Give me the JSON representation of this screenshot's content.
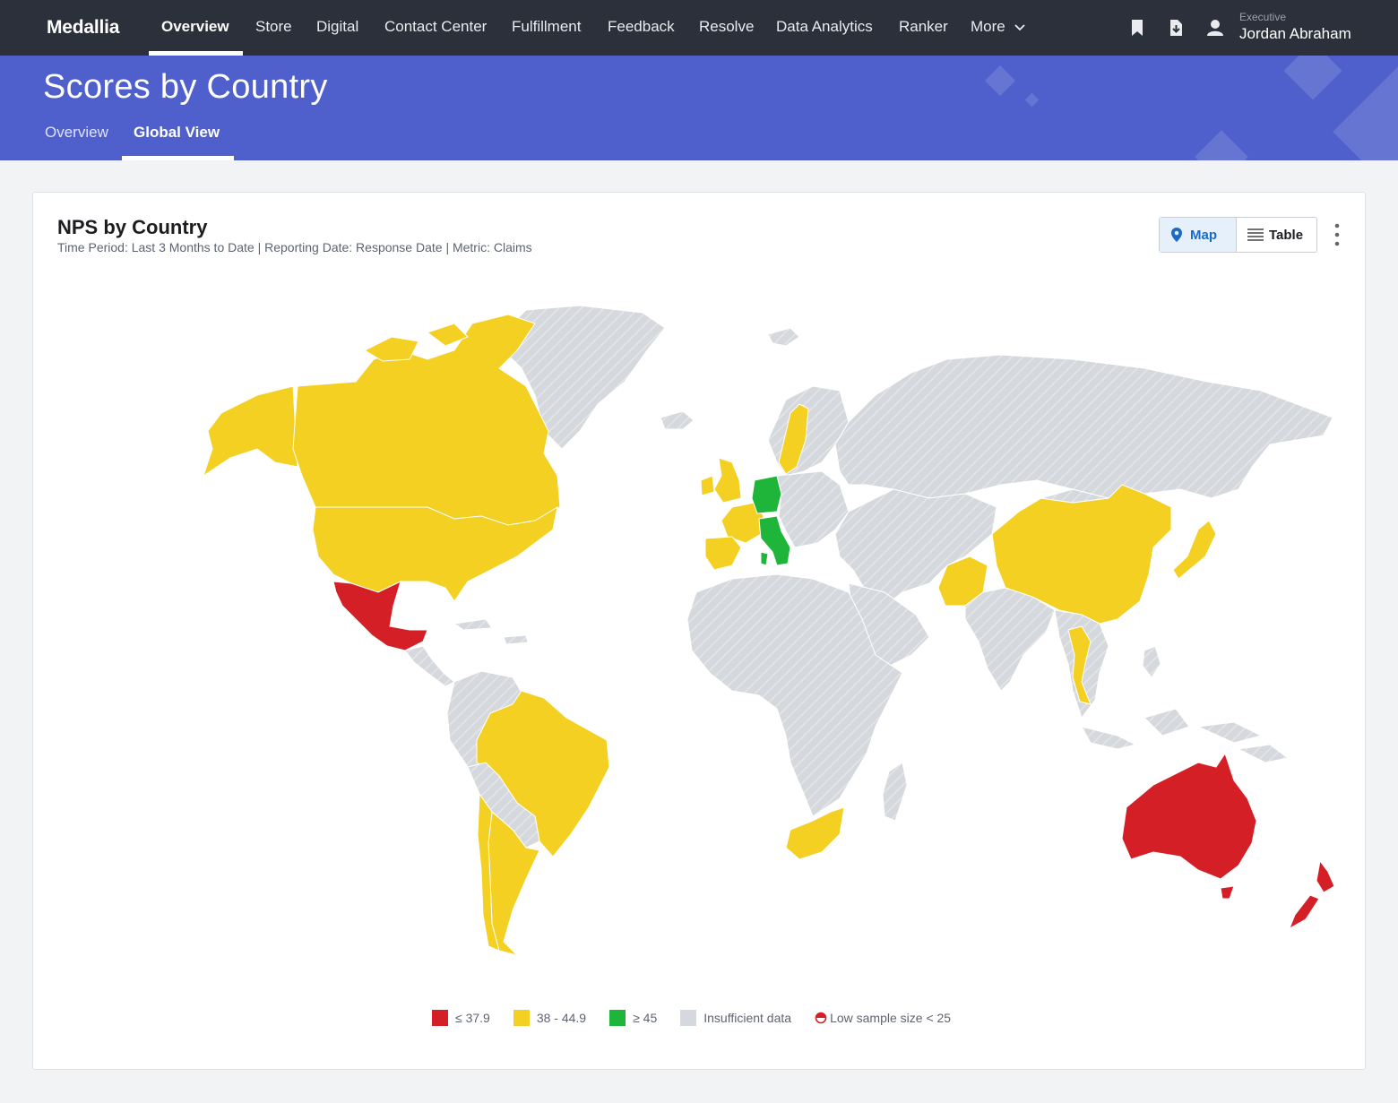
{
  "app": {
    "brand": "Medallia"
  },
  "nav": {
    "items": [
      {
        "label": "Overview",
        "active": true
      },
      {
        "label": "Store"
      },
      {
        "label": "Digital"
      },
      {
        "label": "Contact Center"
      },
      {
        "label": "Fulfillment"
      },
      {
        "label": "Feedback"
      },
      {
        "label": "Resolve"
      },
      {
        "label": "Data Analytics"
      },
      {
        "label": "Ranker"
      },
      {
        "label": "More"
      }
    ],
    "icons": [
      "bookmark-icon",
      "download-icon",
      "user-icon",
      "chevron-down-icon"
    ]
  },
  "user": {
    "role": "Executive",
    "name": "Jordan Abraham"
  },
  "page": {
    "title": "Scores by Country",
    "tabs": [
      {
        "label": "Overview"
      },
      {
        "label": "Global View",
        "active": true
      }
    ]
  },
  "card": {
    "title": "NPS by Country",
    "subtitle": "Time Period: Last 3 Months to Date | Reporting Date: Response Date | Metric: Claims",
    "view_toggle": {
      "map_label": "Map",
      "table_label": "Table",
      "selected": "Map"
    }
  },
  "legend": {
    "items": [
      {
        "label": "≤ 37.9",
        "color": "#d51f26"
      },
      {
        "label": "38 - 44.9",
        "color": "#f4d023"
      },
      {
        "label": "≥ 45",
        "color": "#1eb53a"
      },
      {
        "label": "Insufficient data",
        "color": "#d5d8dc"
      }
    ],
    "low_sample": "Low sample size < 25"
  },
  "colors": {
    "nav_bg": "#2b303a",
    "hero_bg": "#4f5fcb",
    "low": "#d51f26",
    "mid": "#f4d023",
    "high": "#1eb53a",
    "na": "#d5d8dc"
  },
  "map_regions": [
    {
      "region": "Alaska / USA",
      "band": "mid"
    },
    {
      "region": "Canada",
      "band": "mid"
    },
    {
      "region": "United States",
      "band": "mid"
    },
    {
      "region": "Mexico",
      "band": "low"
    },
    {
      "region": "Brazil",
      "band": "mid"
    },
    {
      "region": "Argentina",
      "band": "mid"
    },
    {
      "region": "Chile",
      "band": "mid"
    },
    {
      "region": "United Kingdom",
      "band": "mid"
    },
    {
      "region": "Ireland",
      "band": "mid"
    },
    {
      "region": "France",
      "band": "mid"
    },
    {
      "region": "Spain",
      "band": "mid"
    },
    {
      "region": "Sweden",
      "band": "mid"
    },
    {
      "region": "Germany",
      "band": "high"
    },
    {
      "region": "Italy",
      "band": "high"
    },
    {
      "region": "South Africa",
      "band": "mid"
    },
    {
      "region": "China",
      "band": "mid"
    },
    {
      "region": "Pakistan",
      "band": "mid"
    },
    {
      "region": "Thailand",
      "band": "mid"
    },
    {
      "region": "Japan",
      "band": "mid"
    },
    {
      "region": "Australia",
      "band": "low"
    },
    {
      "region": "New Zealand",
      "band": "low"
    }
  ]
}
